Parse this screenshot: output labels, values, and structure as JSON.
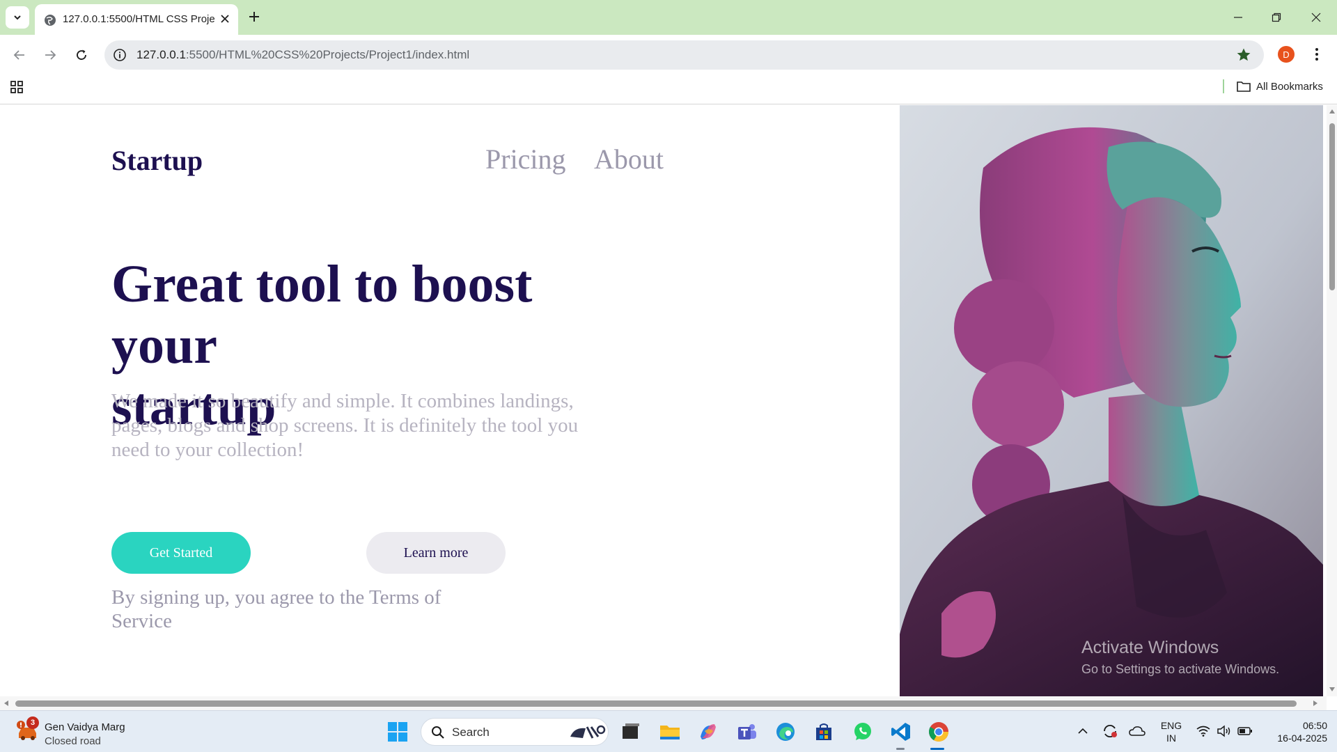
{
  "browser": {
    "tab_title": "127.0.0.1:5500/HTML CSS Proje",
    "url_host": "127.0.0.1",
    "url_path": ":5500/HTML%20CSS%20Projects/Project1/index.html",
    "profile_initial": "D",
    "bookmarks_label": "All Bookmarks"
  },
  "page": {
    "brand": "Startup",
    "nav": {
      "pricing": "Pricing",
      "about": "About"
    },
    "hero_title_line1": "Great tool to boost your",
    "hero_title_line2": "startup",
    "hero_subtitle": "We made it so beautify and simple. It combines landings, pages, blogs and shop screens. It is definitely the tool you need to your collection!",
    "primary_button": "Get Started",
    "secondary_button": "Learn more",
    "terms": "By signing up, you agree to the Terms of Service",
    "colors": {
      "brand_navy": "#1d1050",
      "teal": "#2ad4c0",
      "muted": "#9b98ab"
    }
  },
  "watermark": {
    "line1": "Activate Windows",
    "line2": "Go to Settings to activate Windows."
  },
  "taskbar": {
    "weather_badge": "3",
    "weather_line1": "Gen Vaidya Marg",
    "weather_line2": "Closed road",
    "search_placeholder": "Search",
    "lang_line1": "ENG",
    "lang_line2": "IN",
    "time": "06:50",
    "date": "16-04-2025"
  }
}
